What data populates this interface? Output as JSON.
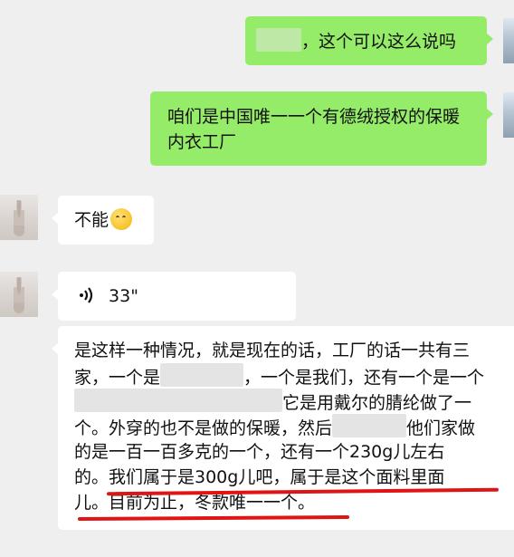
{
  "messages": {
    "m1": {
      "text": "，这个可以这么说吗"
    },
    "m2": {
      "line1": "咱们是中国唯一一个有德绒授权的保暖",
      "line2": "内衣工厂"
    },
    "m3": {
      "text": "不能",
      "emoji": "thinking-face"
    },
    "m4": {
      "duration": "33\""
    },
    "m5": {
      "l1": "是这样一种情况，就是现在的话，工厂的话一共有三",
      "l2a": "家，一个是",
      "l2b": "，一个是我们，还有一个是一个",
      "l3": "它是用戴尔的腈纶做了一",
      "l4a": "个。外穿的也不是做的保暖，然后",
      "l4b": "他们家做",
      "l5": "的是一百一百多克的一个，还有一个230g儿左右",
      "l6": "的。我们属于是300g儿吧，属于是这个面料里面",
      "l7": "儿。目前为止，冬款唯一一个。"
    }
  },
  "colors": {
    "green_bubble": "#95ec69",
    "white_bubble": "#ffffff",
    "annotation": "#e01414"
  }
}
